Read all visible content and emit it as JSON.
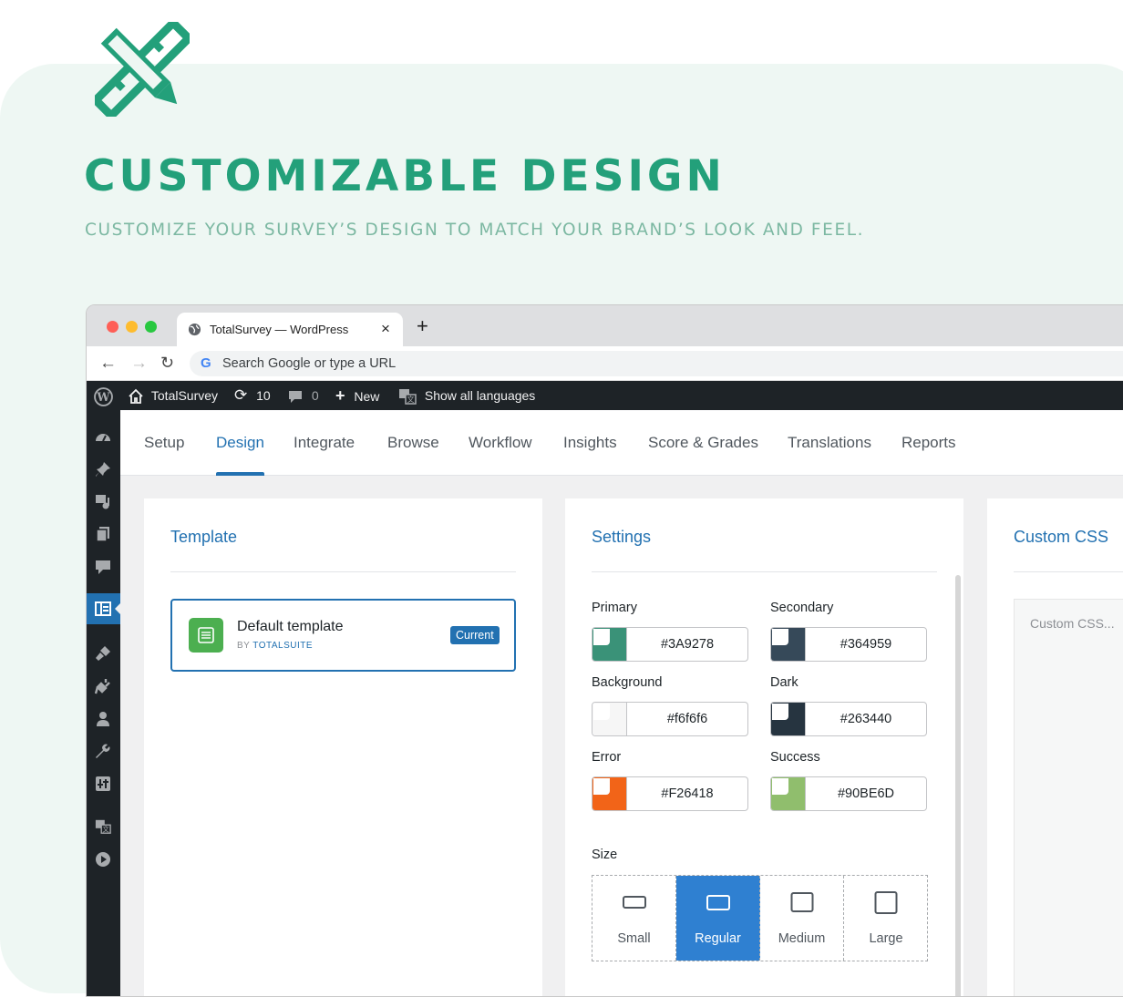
{
  "hero": {
    "title": "CUSTOMIZABLE DESIGN",
    "subtitle": "CUSTOMIZE YOUR SURVEY’S DESIGN TO MATCH YOUR BRAND’S LOOK AND FEEL.",
    "logo_icon": "pencil-ruler-icon",
    "accent_color": "#23a07a"
  },
  "browser": {
    "tab_title": "TotalSurvey — WordPress",
    "tab_close": "×",
    "new_tab": "+",
    "address_placeholder": "Search Google or type a URL"
  },
  "wp_admin_bar": {
    "site_name": "TotalSurvey",
    "updates_count": "10",
    "comments_count": "0",
    "new_label": "New",
    "languages_label": "Show all languages"
  },
  "sidebar": {
    "icons": [
      "dashboard-icon",
      "pin-icon",
      "media-icon",
      "pages-icon",
      "comments-icon",
      "totalsurvey-icon",
      "appearance-icon",
      "plugins-icon",
      "users-icon",
      "tools-icon",
      "settings-icon",
      "translate-icon",
      "play-icon"
    ],
    "active": "totalsurvey-icon"
  },
  "nav": {
    "tabs": [
      "Setup",
      "Design",
      "Integrate",
      "Browse",
      "Workflow",
      "Insights",
      "Score & Grades",
      "Translations",
      "Reports"
    ],
    "active": "Design"
  },
  "template_card": {
    "title": "Template",
    "template_name": "Default template",
    "by_prefix": "BY",
    "by_author": "TOTALSUITE",
    "badge": "Current"
  },
  "settings_card": {
    "title": "Settings",
    "colors": [
      {
        "label": "Primary",
        "value": "#3A9278",
        "swatch": "#3a9278"
      },
      {
        "label": "Secondary",
        "value": "#364959",
        "swatch": "#364959"
      },
      {
        "label": "Background",
        "value": "#f6f6f6",
        "swatch": "#f6f6f6"
      },
      {
        "label": "Dark",
        "value": "#263440",
        "swatch": "#263440"
      },
      {
        "label": "Error",
        "value": "#F26418",
        "swatch": "#f26418"
      },
      {
        "label": "Success",
        "value": "#90BE6D",
        "swatch": "#90be6d"
      }
    ],
    "size_label": "Size",
    "sizes": [
      "Small",
      "Regular",
      "Medium",
      "Large"
    ],
    "selected_size": "Regular"
  },
  "css_card": {
    "title": "Custom CSS",
    "placeholder": "Custom CSS..."
  }
}
